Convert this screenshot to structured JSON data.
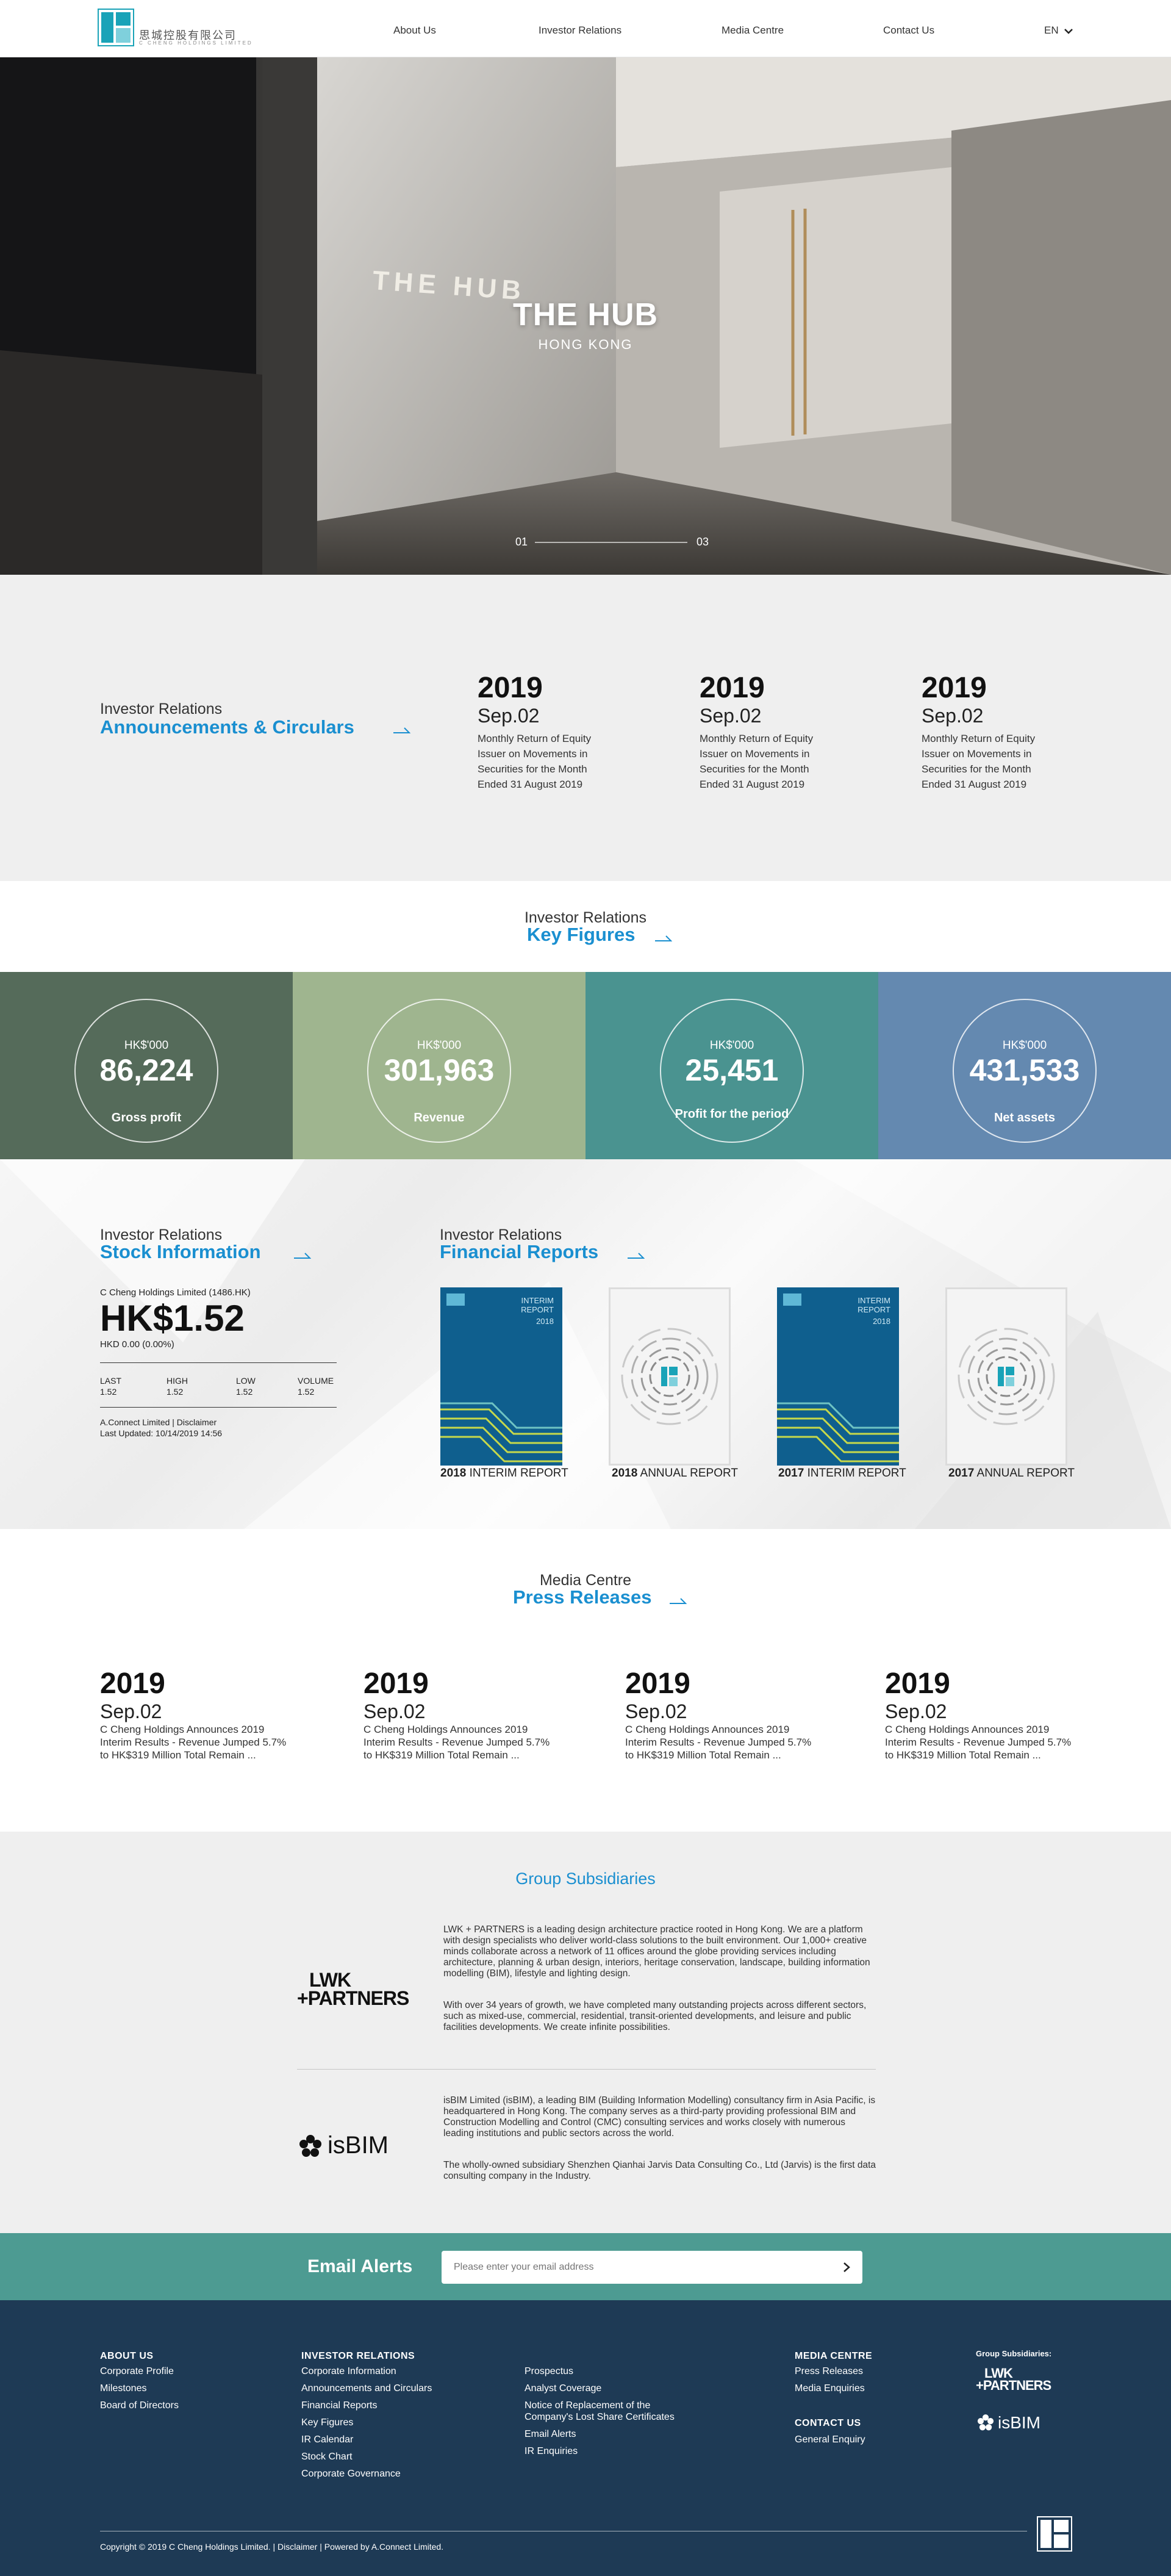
{
  "header": {
    "logo_cn": "思城控股有限公司",
    "logo_en": "C CHENG HOLDINGS LIMITED",
    "nav": [
      "About Us",
      "Investor Relations",
      "Media Centre",
      "Contact Us"
    ],
    "lang": "EN"
  },
  "hero": {
    "sign": "THE HUB",
    "title": "THE HUB",
    "subtitle": "HONG KONG",
    "slide_current": "01",
    "slide_total": "03"
  },
  "announcements": {
    "label": "Investor Relations",
    "title": "Announcements & Circulars",
    "items": [
      {
        "year": "2019",
        "date": "Sep.02",
        "text": "Monthly Return of Equity Issuer on Movements in Securities for the Month Ended 31 August 2019"
      },
      {
        "year": "2019",
        "date": "Sep.02",
        "text": "Monthly Return of Equity Issuer on Movements in Securities for the Month Ended 31 August 2019"
      },
      {
        "year": "2019",
        "date": "Sep.02",
        "text": "Monthly Return of Equity Issuer on Movements in Securities for the Month Ended 31 August 2019"
      }
    ]
  },
  "key_figures": {
    "label": "Investor Relations",
    "title": "Key Figures",
    "items": [
      {
        "unit": "HK$'000",
        "value": "86,224",
        "label": "Gross profit",
        "color": "#556b5a"
      },
      {
        "unit": "HK$'000",
        "value": "301,963",
        "label": "Revenue",
        "color": "#9fb58f"
      },
      {
        "unit": "HK$'000",
        "value": "25,451",
        "label": "Profit for the period",
        "color": "#4a9390"
      },
      {
        "unit": "HK$'000",
        "value": "431,533",
        "label": "Net assets",
        "color": "#6489b0"
      }
    ]
  },
  "stock": {
    "label": "Investor Relations",
    "title": "Stock Information",
    "company": "C Cheng Holdings Limited (1486.HK)",
    "price": "HK$1.52",
    "change": "HKD 0.00 (0.00%)",
    "cols": [
      {
        "k": "LAST",
        "v": "1.52"
      },
      {
        "k": "HIGH",
        "v": "1.52"
      },
      {
        "k": "LOW",
        "v": "1.52"
      },
      {
        "k": "VOLUME",
        "v": "1.52"
      }
    ],
    "source": "A.Connect Limited | Disclaimer",
    "updated": "Last Updated: 10/14/2019 14:56"
  },
  "reports": {
    "label": "Investor Relations",
    "title": "Financial Reports",
    "items": [
      {
        "year": "2018",
        "type": "INTERIM REPORT",
        "cover_title": "INTERIM REPORT",
        "cover_year": "2018",
        "style": "interim"
      },
      {
        "year": "2018",
        "type": "ANNUAL REPORT",
        "cover_title": "",
        "cover_year": "",
        "style": "annual"
      },
      {
        "year": "2017",
        "type": "INTERIM REPORT",
        "cover_title": "INTERIM REPORT",
        "cover_year": "2018",
        "style": "interim"
      },
      {
        "year": "2017",
        "type": "ANNUAL REPORT",
        "cover_title": "",
        "cover_year": "",
        "style": "annual"
      }
    ]
  },
  "press": {
    "label": "Media Centre",
    "title": "Press Releases",
    "items": [
      {
        "year": "2019",
        "date": "Sep.02",
        "text": "C Cheng Holdings Announces 2019 Interim Results - Revenue Jumped 5.7% to HK$319 Million Total Remain ..."
      },
      {
        "year": "2019",
        "date": "Sep.02",
        "text": "C Cheng Holdings Announces 2019 Interim Results - Revenue Jumped 5.7% to HK$319 Million Total Remain ..."
      },
      {
        "year": "2019",
        "date": "Sep.02",
        "text": "C Cheng Holdings Announces 2019 Interim Results - Revenue Jumped 5.7% to HK$319 Million Total Remain ..."
      },
      {
        "year": "2019",
        "date": "Sep.02",
        "text": "C Cheng Holdings Announces 2019 Interim Results - Revenue Jumped 5.7% to HK$319 Million Total Remain ..."
      }
    ]
  },
  "subsidiaries": {
    "title": "Group Subsidiaries",
    "lwk": {
      "logo_line1": "LWK",
      "logo_line2": "+PARTNERS",
      "p1": "LWK + PARTNERS is a leading design architecture practice rooted in Hong Kong. We are a platform with design specialists who deliver world-class solutions to the built environment. Our 1,000+ creative minds collaborate across a network of 11 offices around the globe providing services including architecture, planning & urban design, interiors, heritage conservation, landscape, building information modelling (BIM), lifestyle and lighting design.",
      "p2": "With over 34 years of growth, we have completed many outstanding projects across different sectors, such as mixed-use, commercial, residential, transit-oriented developments, and leisure and public facilities developments. We create infinite possibilities."
    },
    "isbim": {
      "logo": "isBIM",
      "p1": "isBIM Limited (isBIM), a leading BIM (Building Information Modelling) consultancy firm in Asia Pacific, is headquartered in Hong Kong. The company serves as a third-party providing professional BIM and Construction Modelling and Control (CMC) consulting services and works closely with numerous leading institutions and public sectors across the world.",
      "p2": "The wholly-owned subsidiary Shenzhen Qianhai Jarvis Data Consulting Co., Ltd (Jarvis) is the first data consulting company in the Industry."
    }
  },
  "email_alerts": {
    "title": "Email Alerts",
    "placeholder": "Please enter your email address"
  },
  "footer": {
    "about": {
      "title": "ABOUT US",
      "links": [
        "Corporate Profile",
        "Milestones",
        "Board of Directors"
      ]
    },
    "ir": {
      "title": "INVESTOR RELATIONS",
      "links": [
        "Corporate Information",
        "Announcements and Circulars",
        "Financial Reports",
        "Key Figures",
        "IR Calendar",
        "Stock Chart",
        "Corporate Governance"
      ]
    },
    "ir2": {
      "links": [
        "Prospectus",
        "Analyst Coverage",
        "Notice of Replacement of the Company's Lost Share Certificates",
        "Email Alerts",
        "IR Enquiries"
      ]
    },
    "media": {
      "title": "MEDIA CENTRE",
      "links": [
        "Press Releases",
        "Media Enquiries"
      ]
    },
    "contact": {
      "title": "CONTACT US",
      "links": [
        "General Enquiry"
      ]
    },
    "subs": {
      "title": "Group Subsidiaries:",
      "lwk1": "LWK",
      "lwk2": "+PARTNERS",
      "isbim": "isBIM"
    },
    "copyright": "Copyright © 2019 C Cheng Holdings Limited.",
    "disclaimer": "Disclaimer",
    "powered": "Powered by A.Connect Limited."
  }
}
